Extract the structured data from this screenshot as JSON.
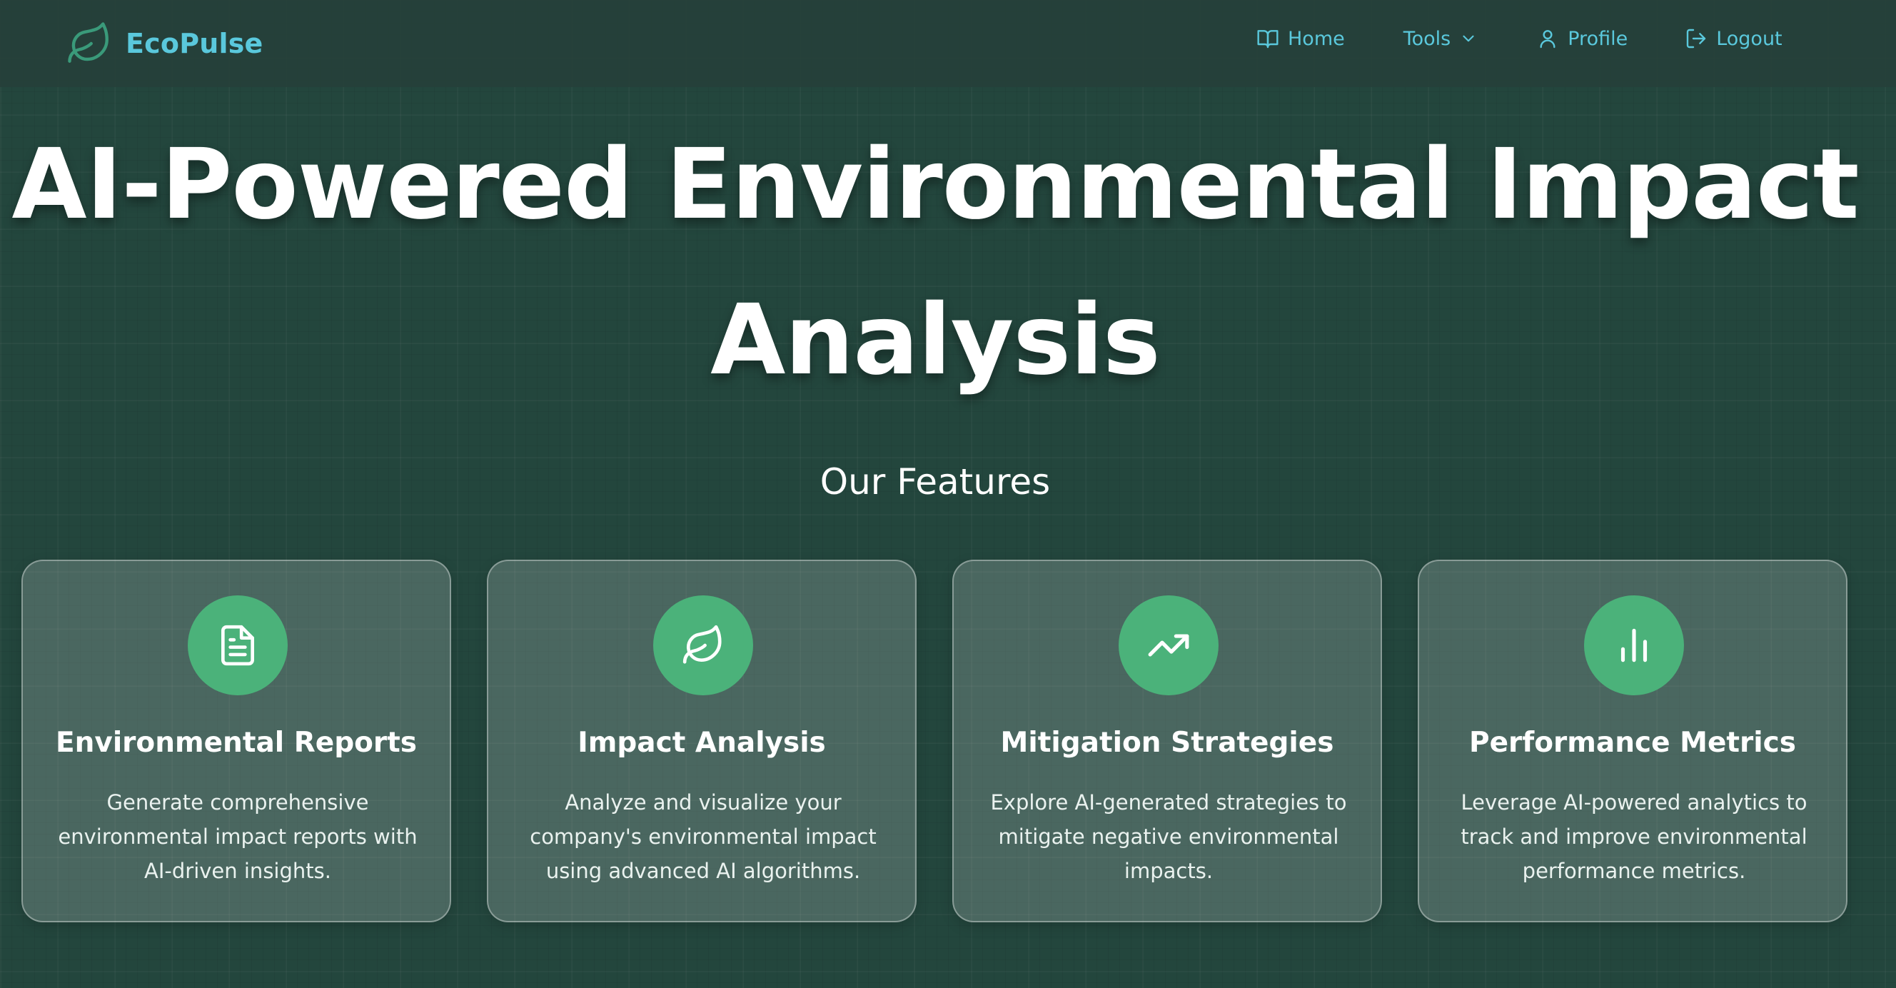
{
  "brand": {
    "name": "EcoPulse",
    "icon": "leaf-icon"
  },
  "nav": {
    "home": {
      "label": "Home",
      "icon": "book-icon"
    },
    "tools": {
      "label": "Tools",
      "icon": "chevron-down-icon"
    },
    "profile": {
      "label": "Profile",
      "icon": "user-icon"
    },
    "logout": {
      "label": "Logout",
      "icon": "logout-icon"
    }
  },
  "hero": {
    "title": "AI-Powered Environmental Impact Analysis"
  },
  "features": {
    "title": "Our Features",
    "cards": [
      {
        "title": "Environmental Reports",
        "description": "Generate comprehensive environmental impact reports with AI-driven insights.",
        "icon": "document-icon"
      },
      {
        "title": "Impact Analysis",
        "description": "Analyze and visualize your company's environmental impact using advanced AI algorithms.",
        "icon": "leaf-icon"
      },
      {
        "title": "Mitigation Strategies",
        "description": "Explore AI-generated strategies to mitigate negative environmental impacts.",
        "icon": "trending-up-icon"
      },
      {
        "title": "Performance Metrics",
        "description": "Leverage AI-powered analytics to track and improve environmental performance metrics.",
        "icon": "bar-chart-icon"
      }
    ]
  },
  "colors": {
    "background": "#23463d",
    "accent": "#5ac8dc",
    "icon_circle": "#4bb27a"
  }
}
